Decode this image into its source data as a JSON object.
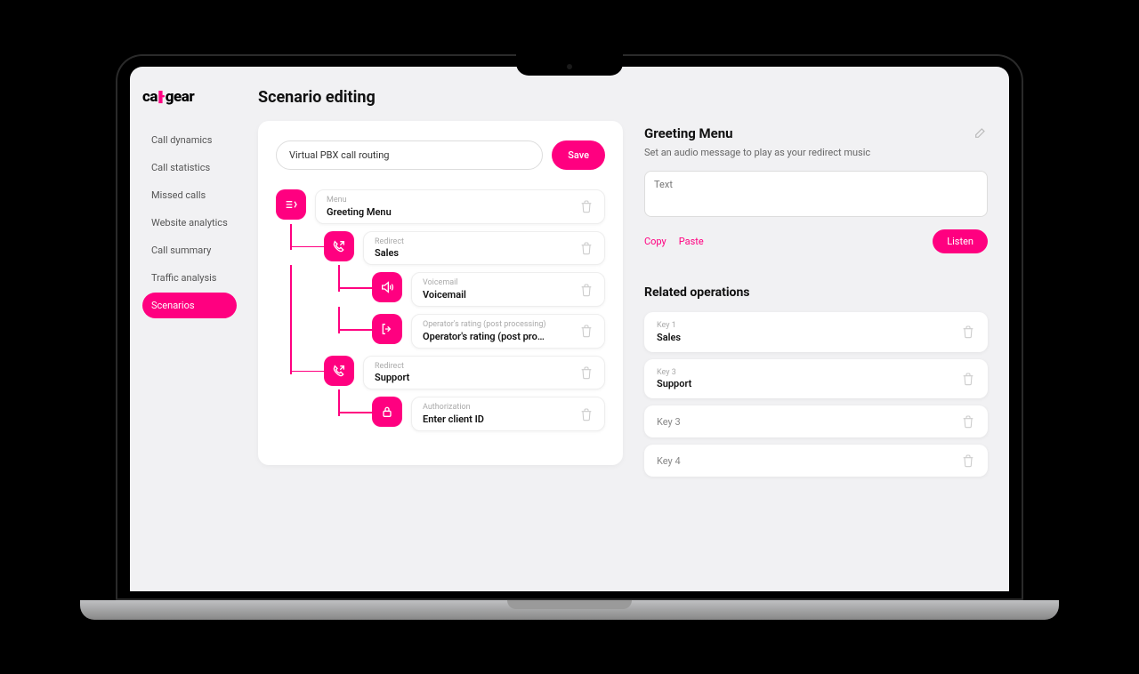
{
  "logo": {
    "left": "ca",
    "mid_bars": "|||",
    "dot": "·",
    "right": "gear"
  },
  "sidebar": {
    "items": [
      {
        "label": "Call dynamics",
        "active": false
      },
      {
        "label": "Call statistics",
        "active": false
      },
      {
        "label": "Missed calls",
        "active": false
      },
      {
        "label": "Website analytics",
        "active": false
      },
      {
        "label": "Call summary",
        "active": false
      },
      {
        "label": "Traffic analysis",
        "active": false
      },
      {
        "label": "Scenarios",
        "active": true
      }
    ]
  },
  "page": {
    "title": "Scenario editing"
  },
  "scenario": {
    "name": "Virtual PBX call routing",
    "save_label": "Save",
    "nodes": {
      "root": {
        "type": "Menu",
        "title": "Greeting Menu"
      },
      "child1": {
        "type": "Redirect",
        "title": "Sales"
      },
      "child1a": {
        "type": "Voicemail",
        "title": "Voicemail"
      },
      "child1b": {
        "type": "Operator's rating (post processing)",
        "title": "Operator's rating (post pro…"
      },
      "child2": {
        "type": "Redirect",
        "title": "Support"
      },
      "child2a": {
        "type": "Authorization",
        "title": "Enter client ID"
      }
    }
  },
  "rightPanel": {
    "title": "Greeting Menu",
    "subtitle": "Set an audio message to play as your redirect music",
    "text_placeholder": "Text",
    "copy_label": "Copy",
    "paste_label": "Paste",
    "listen_label": "Listen",
    "related_title": "Related operations",
    "ops": [
      {
        "key": "Key 1",
        "label": "Sales",
        "filled": true
      },
      {
        "key": "Key 3",
        "label": "Support",
        "filled": true
      },
      {
        "key": "",
        "label": "Key 3",
        "filled": false
      },
      {
        "key": "",
        "label": "Key 4",
        "filled": false
      }
    ]
  }
}
